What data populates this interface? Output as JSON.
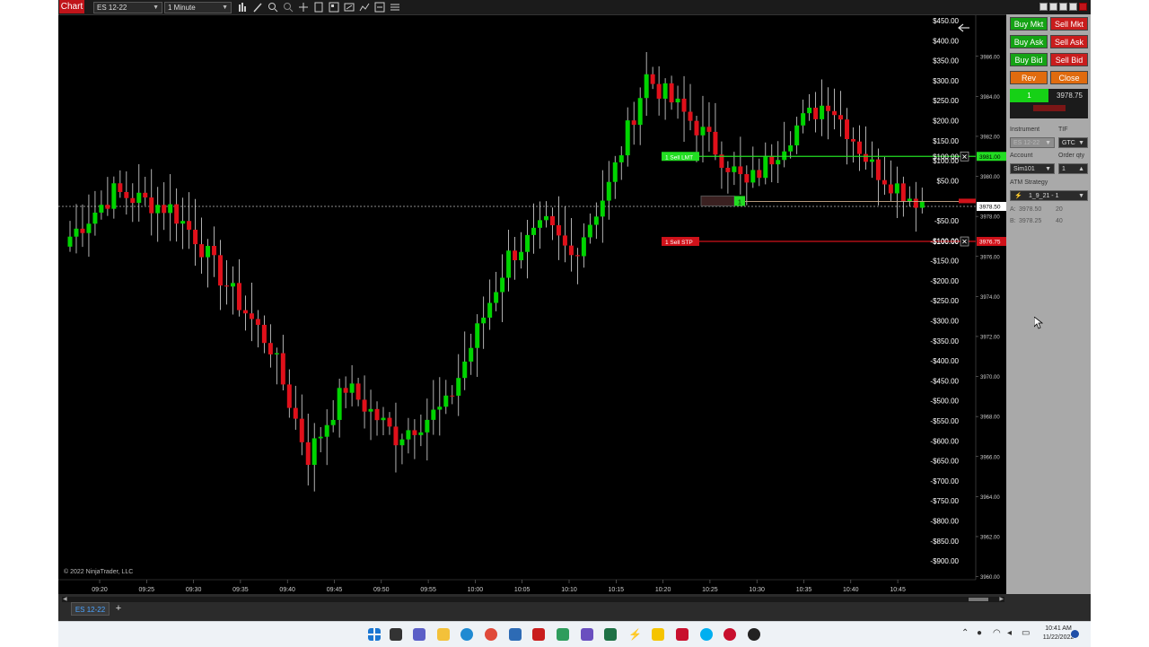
{
  "toolbar": {
    "chart_tab_label": "Chart",
    "instrument": "ES 12-22",
    "interval": "1 Minute"
  },
  "chart": {
    "copyright": "© 2022 NinjaTrader, LLC",
    "current_price_label": "3978.50",
    "pnl_axis_labels": [
      "$450.00",
      "$400.00",
      "$350.00",
      "$300.00",
      "$250.00",
      "$200.00",
      "$150.00",
      "$100.00",
      "$50.00",
      "-$50.00",
      "-$100.00",
      "-$150.00",
      "-$200.00",
      "-$250.00",
      "-$300.00",
      "-$350.00",
      "-$400.00",
      "-$450.00",
      "-$500.00",
      "-$550.00",
      "-$600.00",
      "-$650.00",
      "-$700.00",
      "-$750.00",
      "-$800.00",
      "-$850.00",
      "-$900.00"
    ],
    "price_axis_labels": [
      "3986.00",
      "3984.00",
      "3982.00",
      "3980.00",
      "3978.00",
      "3976.00",
      "3974.00",
      "3972.00",
      "3970.00",
      "3968.00",
      "3966.00",
      "3964.00",
      "3962.00",
      "3960.00"
    ],
    "time_labels": [
      "09:20",
      "09:25",
      "09:30",
      "09:35",
      "09:40",
      "09:45",
      "09:50",
      "09:55",
      "10:00",
      "10:05",
      "10:10",
      "10:15",
      "10:20",
      "10:25",
      "10:30",
      "10:35",
      "10:40",
      "10:45"
    ],
    "orders": {
      "sell_limit_label": "1  Sell LMT",
      "sell_limit_price": "3981.00",
      "sell_stop_label": "1  Sell STP",
      "sell_stop_price": "3976.75",
      "sell_stop_pnl": "-$100.00",
      "sell_limit_pnl": "$100.00",
      "position_qty": "1"
    }
  },
  "panel": {
    "buy_mkt": "Buy Mkt",
    "sell_mkt": "Sell Mkt",
    "buy_ask": "Buy Ask",
    "sell_ask": "Sell Ask",
    "buy_bid": "Buy Bid",
    "sell_bid": "Sell Bid",
    "rev": "Rev",
    "close": "Close",
    "position_qty": "1",
    "position_price": "3978.75",
    "instrument_label": "Instrument",
    "tif_label": "TIF",
    "instrument_value": "ES 12-22",
    "tif_value": "GTC",
    "account_label": "Account",
    "order_qty_label": "Order qty",
    "account_value": "Sim101",
    "order_qty_value": "1",
    "atm_label": "ATM Strategy",
    "atm_value": "1_9_21 - 1",
    "ask_label": "A:",
    "ask_price": "3978.50",
    "ask_size": "20",
    "bid_label": "B:",
    "bid_price": "3978.25",
    "bid_size": "40"
  },
  "bottom": {
    "tab_label": "ES 12-22",
    "add_tab": "+"
  },
  "taskbar": {
    "time": "10:41 AM",
    "date": "11/22/2022"
  },
  "colors": {
    "up": "#00d400",
    "down": "#e0101a",
    "limit_line": "#22dd22",
    "stop_line": "#d0121a"
  }
}
